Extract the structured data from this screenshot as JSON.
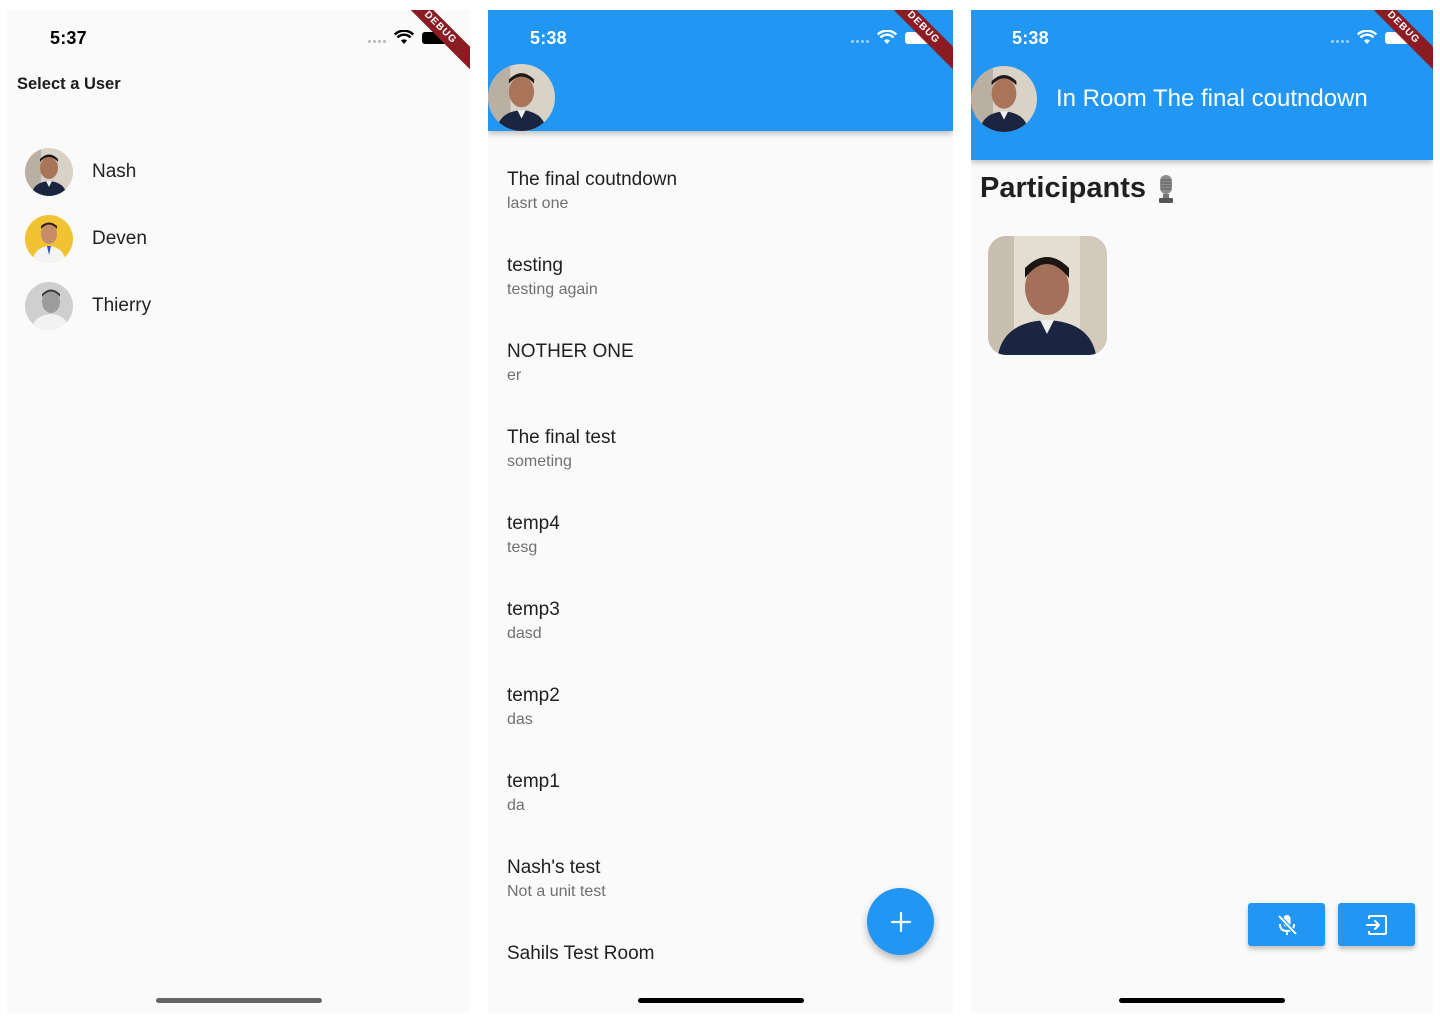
{
  "screen1": {
    "time": "5:37",
    "debug": "DEBUG",
    "title": "Select a User",
    "users": [
      {
        "name": "Nash",
        "avatar": "nash-avatar"
      },
      {
        "name": "Deven",
        "avatar": "deven-avatar"
      },
      {
        "name": "Thierry",
        "avatar": "thierry-avatar"
      }
    ]
  },
  "screen2": {
    "time": "5:38",
    "debug": "DEBUG",
    "rooms": [
      {
        "name": "The final coutndown",
        "description": "lasrt one"
      },
      {
        "name": "testing",
        "description": "testing again"
      },
      {
        "name": "NOTHER ONE",
        "description": "er"
      },
      {
        "name": "The final test",
        "description": "someting"
      },
      {
        "name": "temp4",
        "description": "tesg"
      },
      {
        "name": "temp3",
        "description": "dasd"
      },
      {
        "name": "temp2",
        "description": "das"
      },
      {
        "name": "temp1",
        "description": "da"
      },
      {
        "name": "Nash's test",
        "description": "Not a unit test"
      },
      {
        "name": "Sahils Test Room",
        "description": ""
      }
    ],
    "fab_icon": "plus-icon"
  },
  "screen3": {
    "time": "5:38",
    "debug": "DEBUG",
    "title": "In Room The final coutndown",
    "participants_heading": "Participants",
    "heading_icon": "microphone-icon",
    "mute_icon": "mic-off-icon",
    "leave_icon": "exit-icon"
  },
  "colors": {
    "primary": "#2196f3",
    "background": "#fafafa",
    "debug_banner": "#8b1c24"
  }
}
